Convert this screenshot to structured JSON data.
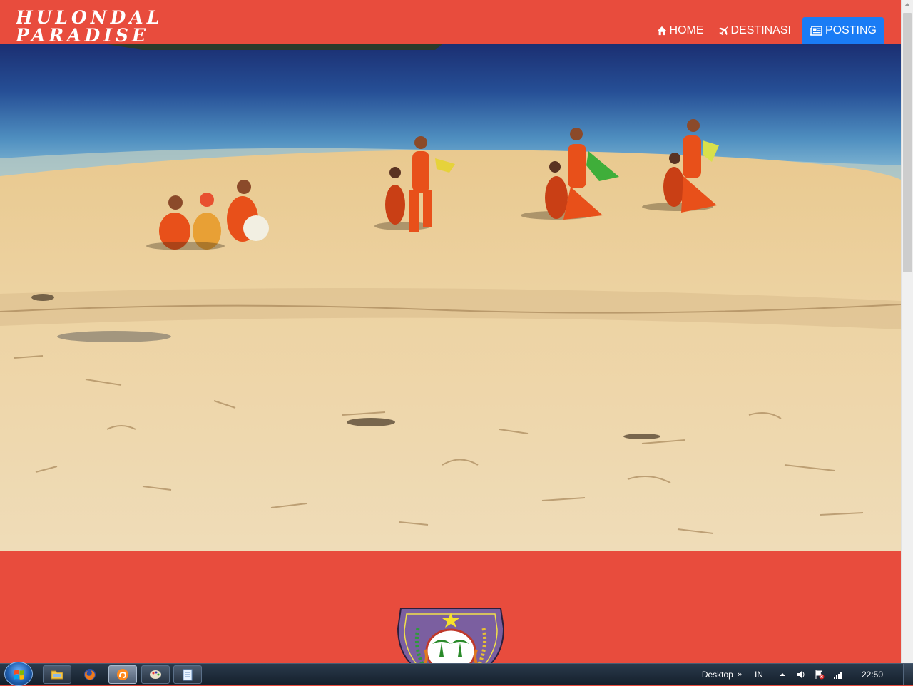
{
  "brand": {
    "line1": "HULONDALO",
    "line2": "PARADISE"
  },
  "nav": {
    "items": [
      {
        "label": "HOME",
        "icon": "home-icon",
        "active": false
      },
      {
        "label": "DESTINASI",
        "icon": "plane-icon",
        "active": false
      },
      {
        "label": "POSTING",
        "icon": "newspaper-icon",
        "active": true
      }
    ]
  },
  "hero": {
    "image": "beach-dance-performance"
  },
  "logo_section": {
    "emblem": "gorontalo-emblem"
  },
  "colors": {
    "header_bg": "#e84c3d",
    "active_nav": "#1a7cf5",
    "text": "#ffffff"
  },
  "taskbar": {
    "desktop_label": "Desktop",
    "chevron": "»",
    "language": "IN",
    "clock": "22:50",
    "apps": [
      "windows-explorer-icon",
      "firefox-icon",
      "uc-browser-icon",
      "paint-icon",
      "notepad-icon"
    ]
  }
}
